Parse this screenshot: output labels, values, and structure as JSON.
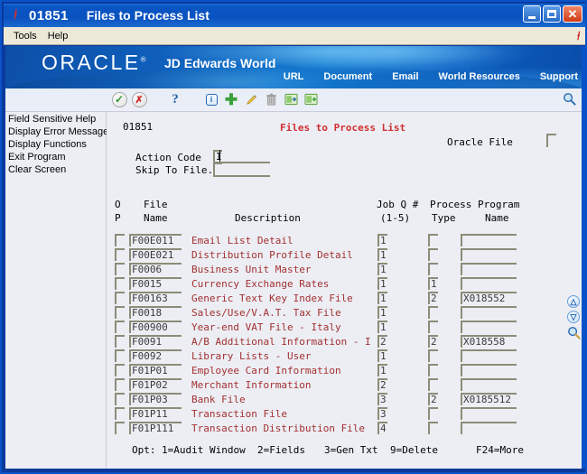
{
  "window": {
    "icon": "jde-logo-icon",
    "program_number": "01851",
    "title": "Files to Process List",
    "minimize_label": "_",
    "maximize_label": "□",
    "close_label": "✕"
  },
  "menubar": {
    "items": [
      {
        "label": "Tools"
      },
      {
        "label": "Help"
      }
    ],
    "logo": "jde-logo-icon"
  },
  "banner": {
    "brand": "ORACLE",
    "brand_reg": "®",
    "product": "JD Edwards World",
    "nav": [
      {
        "label": "URL"
      },
      {
        "label": "Document"
      },
      {
        "label": "Email"
      },
      {
        "label": "World Resources"
      },
      {
        "label": "Support"
      }
    ],
    "bg_color": "#0f61bd"
  },
  "toolbar": {
    "icons": [
      {
        "name": "ok-check-icon",
        "glyph": "✔"
      },
      {
        "name": "cancel-x-icon",
        "glyph": "✘"
      },
      {
        "name": "help-question-icon",
        "glyph": "?"
      },
      {
        "name": "info-icon",
        "glyph": "i"
      },
      {
        "name": "add-plus-icon",
        "glyph": "✚"
      },
      {
        "name": "edit-pencil-icon",
        "glyph": "✎"
      },
      {
        "name": "delete-trash-icon",
        "glyph": "🗑"
      },
      {
        "name": "import-icon",
        "glyph": "⇥"
      },
      {
        "name": "export-icon",
        "glyph": "⇤"
      }
    ],
    "search_icon": "search-magnifier-icon"
  },
  "sidebar": {
    "items": [
      {
        "label": "Field Sensitive Help"
      },
      {
        "label": "Display Error Message"
      },
      {
        "label": "Display Functions"
      },
      {
        "label": "Exit Program"
      },
      {
        "label": "Clear Screen"
      }
    ]
  },
  "form": {
    "program_id": "01851",
    "title": "Files to Process List",
    "title_color": "#d03030",
    "oracle_file_label": "Oracle File",
    "oracle_file_value": "",
    "action_code_label": "Action Code",
    "action_code_value": "I",
    "skip_to_file_label": "Skip To File.",
    "skip_to_file_value": ""
  },
  "table": {
    "headers_line1": {
      "opt": "O",
      "file": "File",
      "description": "",
      "jobq": "Job Q #",
      "process": "Process",
      "program": "Program"
    },
    "headers_line2": {
      "opt": "P",
      "file": "Name",
      "description": "Description",
      "jobq": "(1-5)",
      "process": "Type",
      "program": "Name"
    },
    "rows": [
      {
        "opt": "",
        "file": "F00E011",
        "description": "Email List Detail",
        "jobq": "1",
        "process": "",
        "program": ""
      },
      {
        "opt": "",
        "file": "F00E021",
        "description": "Distribution Profile Detail",
        "jobq": "1",
        "process": "",
        "program": ""
      },
      {
        "opt": "",
        "file": "F0006",
        "description": "Business Unit Master",
        "jobq": "1",
        "process": "",
        "program": ""
      },
      {
        "opt": "",
        "file": "F0015",
        "description": "Currency Exchange Rates",
        "jobq": "1",
        "process": "1",
        "program": ""
      },
      {
        "opt": "",
        "file": "F00163",
        "description": "Generic Text Key Index File",
        "jobq": "1",
        "process": "2",
        "program": "X018552"
      },
      {
        "opt": "",
        "file": "F0018",
        "description": "Sales/Use/V.A.T. Tax File",
        "jobq": "1",
        "process": "",
        "program": ""
      },
      {
        "opt": "",
        "file": "F00900",
        "description": "Year-end VAT File - Italy",
        "jobq": "1",
        "process": "",
        "program": ""
      },
      {
        "opt": "",
        "file": "F0091",
        "description": "A/B Additional Information - I",
        "jobq": "2",
        "process": "2",
        "program": "X018558"
      },
      {
        "opt": "",
        "file": "F0092",
        "description": "Library Lists - User",
        "jobq": "1",
        "process": "",
        "program": ""
      },
      {
        "opt": "",
        "file": "F01P01",
        "description": "Employee Card Information",
        "jobq": "1",
        "process": "",
        "program": ""
      },
      {
        "opt": "",
        "file": "F01P02",
        "description": "Merchant Information",
        "jobq": "2",
        "process": "",
        "program": ""
      },
      {
        "opt": "",
        "file": "F01P03",
        "description": "Bank File",
        "jobq": "3",
        "process": "2",
        "program": "X0185512"
      },
      {
        "opt": "",
        "file": "F01P11",
        "description": "Transaction File",
        "jobq": "3",
        "process": "",
        "program": ""
      },
      {
        "opt": "",
        "file": "F01P111",
        "description": "Transaction Distribution File",
        "jobq": "4",
        "process": "",
        "program": ""
      }
    ]
  },
  "footer": {
    "opts_label": "Opt:",
    "opts": [
      {
        "label": "1=Audit Window"
      },
      {
        "label": "2=Fields"
      },
      {
        "label": "3=Gen Txt"
      },
      {
        "label": "9=Delete"
      }
    ],
    "more_key": "F24=More"
  },
  "scroll": {
    "up_label": "⌃",
    "down_label": "⌄",
    "search_icon": "search-magnifier-icon"
  }
}
